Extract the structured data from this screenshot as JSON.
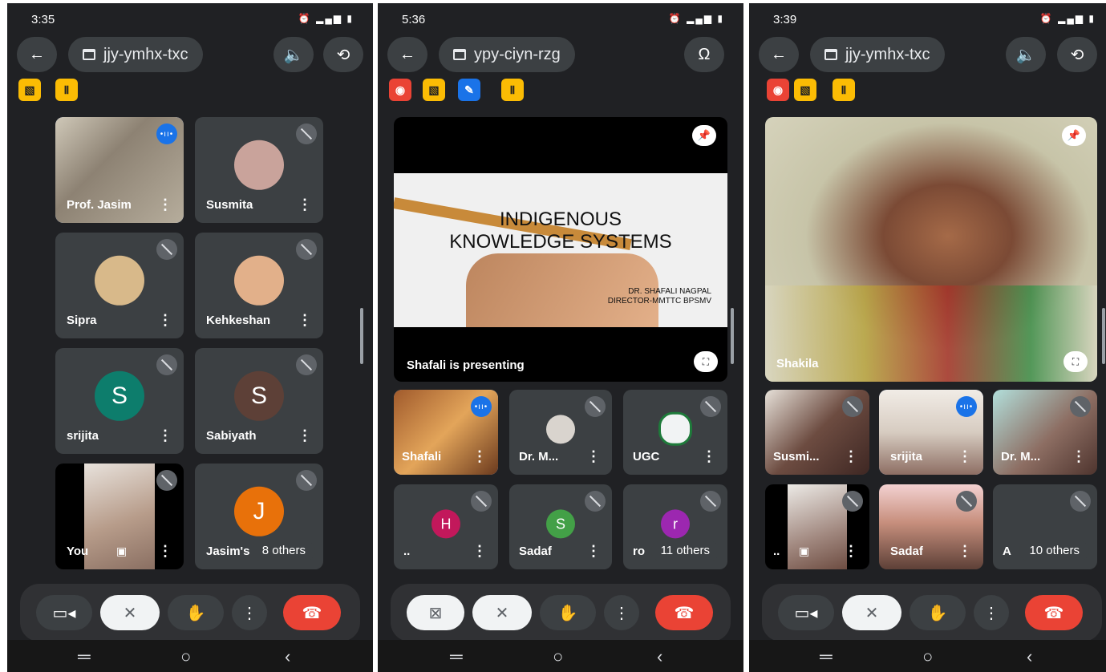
{
  "colors": {
    "bg": "#202124",
    "tile": "#3c4043",
    "accent_blue": "#1a73e8",
    "end_red": "#ea4335",
    "badge_yellow": "#fbbc04"
  },
  "phone1": {
    "time": "3:35",
    "meeting_code": "jjy-ymhx-txc",
    "tiles": [
      {
        "name": "Prof. Jasim"
      },
      {
        "name": "Susmita"
      },
      {
        "name": "Sipra"
      },
      {
        "name": "Kehkeshan"
      },
      {
        "name": "srijita",
        "initial": "S"
      },
      {
        "name": "Sabiyath",
        "initial": "S"
      },
      {
        "name": "You"
      },
      {
        "name": "Jasim's",
        "initial": "J",
        "others": "8 others"
      }
    ]
  },
  "phone2": {
    "time": "5:36",
    "meeting_code": "ypy-ciyn-rzg",
    "presentation": {
      "line1": "INDIGENOUS",
      "line2": "KNOWLEDGE SYSTEMS",
      "author": "DR. SHAFALI NAGPAL",
      "role": "DIRECTOR-MMTTC BPSMV",
      "caption": "Shafali is presenting"
    },
    "tiles": [
      {
        "name": "Shafali"
      },
      {
        "name": "Dr. M..."
      },
      {
        "name": "UGC"
      },
      {
        "name": "..",
        "initial": "H"
      },
      {
        "name": "Sadaf",
        "initial": "S"
      },
      {
        "name": "ro",
        "initial": "r",
        "others": "11 others"
      }
    ]
  },
  "phone3": {
    "time": "3:39",
    "meeting_code": "jjy-ymhx-txc",
    "main_speaker": "Shakila",
    "tiles": [
      {
        "name": "Susmi..."
      },
      {
        "name": "srijita"
      },
      {
        "name": "Dr. M..."
      },
      {
        "name": ".."
      },
      {
        "name": "Sadaf"
      },
      {
        "name": "A",
        "others": "10 others"
      }
    ]
  }
}
